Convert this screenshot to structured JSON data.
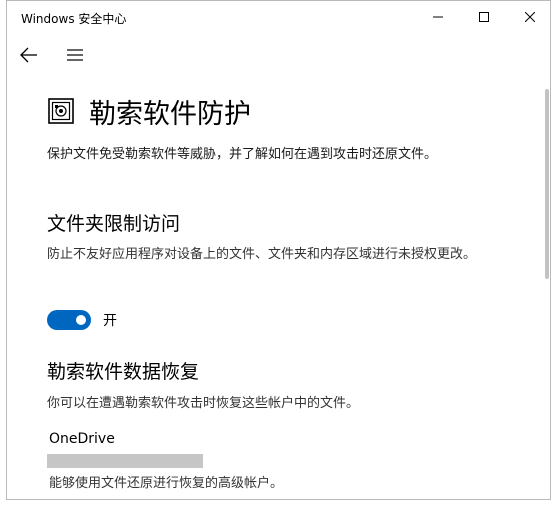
{
  "window": {
    "title": "Windows 安全中心"
  },
  "titlebar": {
    "minimize_icon": "minimize-icon",
    "maximize_icon": "maximize-icon",
    "close_icon": "close-icon"
  },
  "nav": {
    "back_icon": "back-arrow-icon",
    "menu_icon": "hamburger-menu-icon"
  },
  "page": {
    "icon": "ransomware-protection-icon",
    "title": "勒索软件防护",
    "description": "保护文件免受勒索软件等威胁，并了解如何在遇到攻击时还原文件。"
  },
  "controlled_folder_access": {
    "title": "文件夹限制访问",
    "description": "防止不友好应用程序对设备上的文件、文件夹和内存区域进行未授权更改。",
    "toggle_state": "on",
    "toggle_label": "开"
  },
  "data_recovery": {
    "title": "勒索软件数据恢复",
    "description": "你可以在遭遇勒索软件攻击时恢复这些帐户中的文件。",
    "provider": "OneDrive",
    "provider_description": "能够使用文件还原进行恢复的高级帐户。"
  },
  "colors": {
    "accent": "#0067c0",
    "redacted_bar": "#c6c6c6"
  }
}
